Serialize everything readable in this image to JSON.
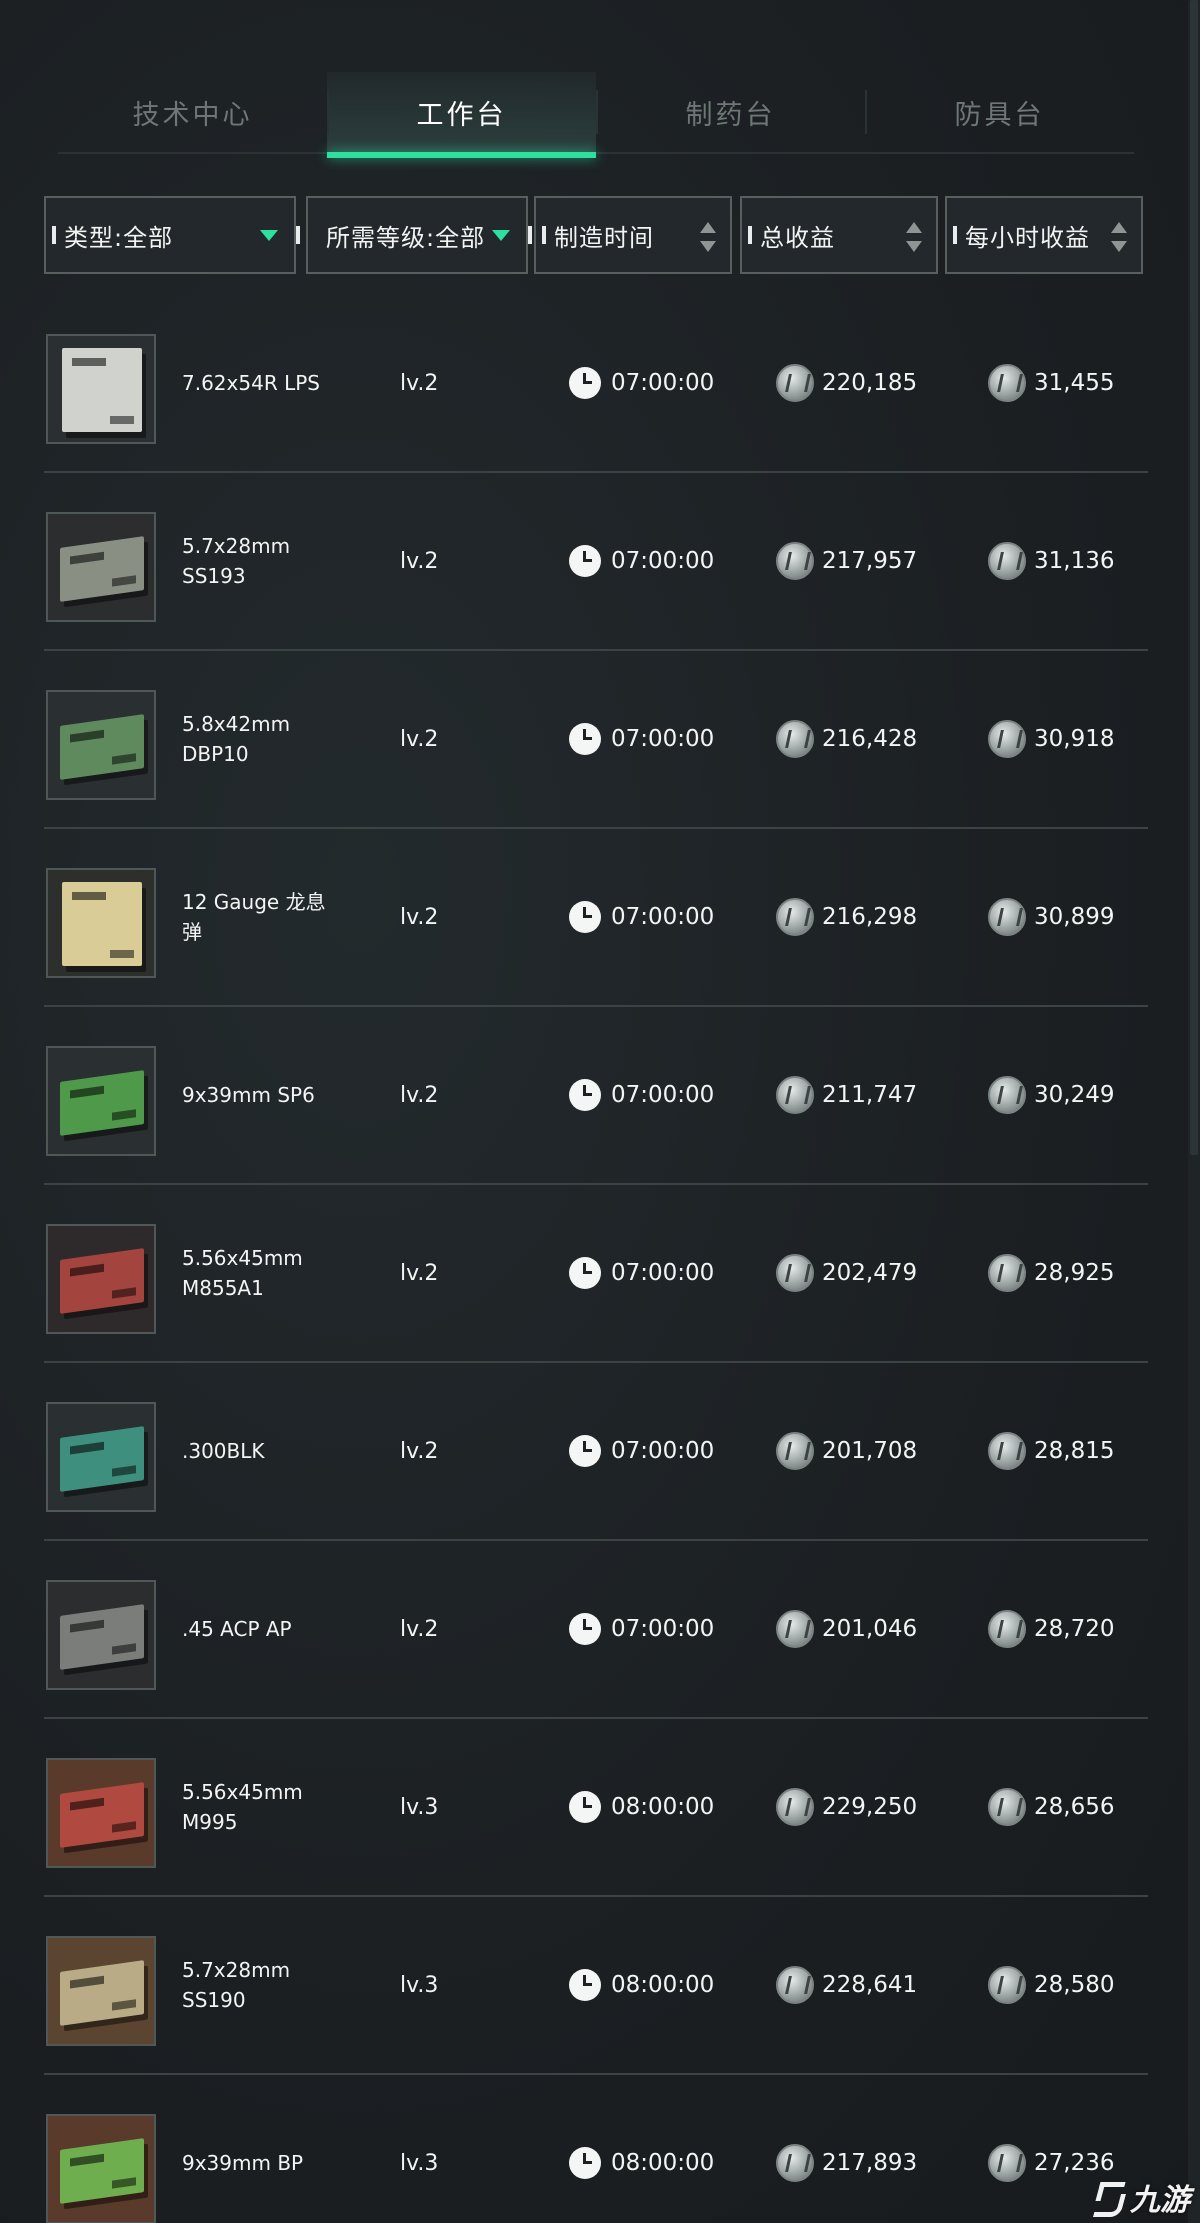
{
  "tabs": [
    {
      "label": "技术中心"
    },
    {
      "label": "工作台"
    },
    {
      "label": "制药台"
    },
    {
      "label": "防具台"
    }
  ],
  "filters": {
    "type": "类型:全部",
    "level": "所需等级:全部",
    "time": "制造时间",
    "total": "总收益",
    "hourly": "每小时收益"
  },
  "rows": [
    {
      "name": "7.62x54R LPS",
      "level": "lv.2",
      "time": "07:00:00",
      "total": "220,185",
      "hourly": "31,455",
      "box_color": "#cfd2cd",
      "box_style": "tall"
    },
    {
      "name": "5.7x28mm SS193",
      "level": "lv.2",
      "time": "07:00:00",
      "total": "217,957",
      "hourly": "31,136",
      "box_color": "#8a8f84",
      "box_style": "flat"
    },
    {
      "name": "5.8x42mm DBP10",
      "level": "lv.2",
      "time": "07:00:00",
      "total": "216,428",
      "hourly": "30,918",
      "box_color": "#5f8a5e",
      "box_style": "flat"
    },
    {
      "name": "12 Gauge 龙息弹",
      "level": "lv.2",
      "time": "07:00:00",
      "total": "216,298",
      "hourly": "30,899",
      "box_color": "#d9cc97",
      "box_style": "tall"
    },
    {
      "name": "9x39mm SP6",
      "level": "lv.2",
      "time": "07:00:00",
      "total": "211,747",
      "hourly": "30,249",
      "box_color": "#4f9a4a",
      "box_style": "flat"
    },
    {
      "name": "5.56x45mm M855A1",
      "level": "lv.2",
      "time": "07:00:00",
      "total": "202,479",
      "hourly": "28,925",
      "box_color": "#a3443f",
      "box_style": "flat"
    },
    {
      "name": ".300BLK",
      "level": "lv.2",
      "time": "07:00:00",
      "total": "201,708",
      "hourly": "28,815",
      "box_color": "#3f8f7f",
      "box_style": "flat"
    },
    {
      "name": ".45 ACP AP",
      "level": "lv.2",
      "time": "07:00:00",
      "total": "201,046",
      "hourly": "28,720",
      "box_color": "#7a7d7a",
      "box_style": "flat"
    },
    {
      "name": "5.56x45mm M995",
      "level": "lv.3",
      "time": "08:00:00",
      "total": "229,250",
      "hourly": "28,656",
      "box_color": "#b0493f",
      "box_style": "flat"
    },
    {
      "name": "5.7x28mm SS190",
      "level": "lv.3",
      "time": "08:00:00",
      "total": "228,641",
      "hourly": "28,580",
      "box_color": "#b9ab85",
      "box_style": "flat"
    },
    {
      "name": "9x39mm BP",
      "level": "lv.3",
      "time": "08:00:00",
      "total": "217,893",
      "hourly": "27,236",
      "box_color": "#6fae4f",
      "box_style": "flat"
    }
  ],
  "thumb_bg": [
    "#2a2f31",
    "#2b2d2e",
    "#2a2f31",
    "#2c2f2c",
    "#2a2f31",
    "#2e2a2b",
    "#2a2f31",
    "#2b2d2e",
    "#5a3a2a",
    "#5b4530",
    "#5a3a2a"
  ],
  "watermark": {
    "text": "九游"
  },
  "colors": {
    "accent": "#2de0a0",
    "background": "#1d2124",
    "text": "#f3f5f4",
    "tab_inactive": "#6e7776"
  }
}
